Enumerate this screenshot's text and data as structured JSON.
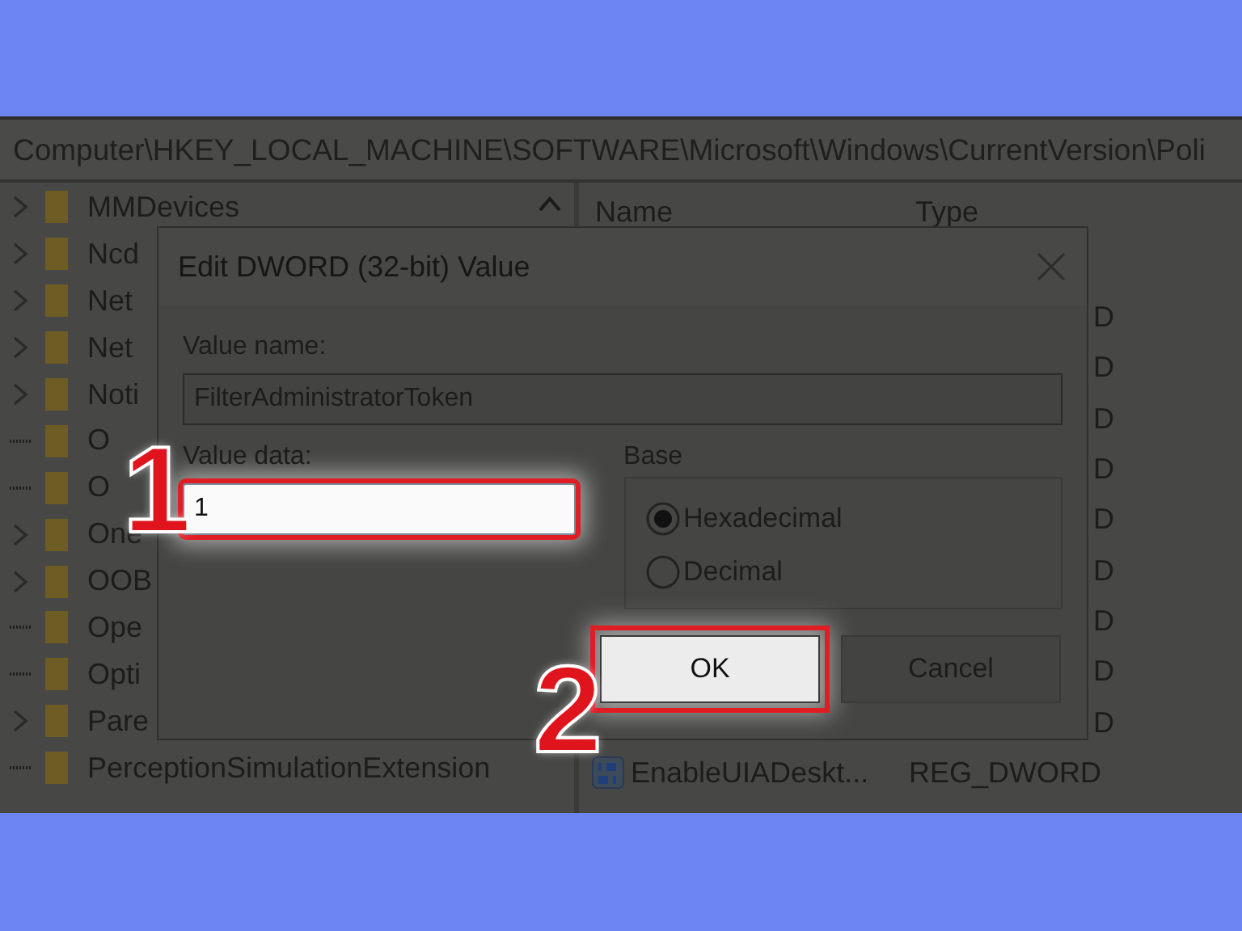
{
  "address_bar": {
    "path": "Computer\\HKEY_LOCAL_MACHINE\\SOFTWARE\\Microsoft\\Windows\\CurrentVersion\\Poli"
  },
  "tree": {
    "items": [
      {
        "label": "MMDevices",
        "expandable": true
      },
      {
        "label": "Ncd",
        "expandable": true
      },
      {
        "label": "Net",
        "expandable": true
      },
      {
        "label": "Net",
        "expandable": true
      },
      {
        "label": "Noti",
        "expandable": true
      },
      {
        "label": "O",
        "expandable": false
      },
      {
        "label": "O",
        "expandable": false
      },
      {
        "label": "One",
        "expandable": true
      },
      {
        "label": "OOB",
        "expandable": true
      },
      {
        "label": "Ope",
        "expandable": false
      },
      {
        "label": "Opti",
        "expandable": false
      },
      {
        "label": "Pare",
        "expandable": true
      },
      {
        "label": "PerceptionSimulationExtension",
        "expandable": false
      }
    ]
  },
  "list": {
    "columns": [
      "Name",
      "Type"
    ],
    "rows": [
      {
        "type": "D"
      },
      {
        "type": "D"
      },
      {
        "type": "D"
      },
      {
        "type": "D"
      },
      {
        "type": "D"
      },
      {
        "type": "D"
      },
      {
        "type": "D"
      },
      {
        "type": "D"
      },
      {
        "type": "D"
      },
      {
        "name": "EnableUIADeskt...",
        "type": "REG_DWORD"
      }
    ]
  },
  "dialog": {
    "title": "Edit DWORD (32-bit) Value",
    "value_name_label": "Value name:",
    "value_name": "FilterAdministratorToken",
    "value_data_label": "Value data:",
    "value_data": "1",
    "value_data_highlighted": true,
    "base": {
      "label": "Base",
      "options": [
        {
          "label": "Hexadecimal",
          "selected": true
        },
        {
          "label": "Decimal",
          "selected": false
        }
      ]
    },
    "buttons": [
      {
        "label": "OK",
        "highlighted": true
      },
      {
        "label": "Cancel",
        "highlighted": false
      }
    ]
  },
  "annotations": [
    {
      "label": "1"
    },
    {
      "label": "2"
    }
  ]
}
